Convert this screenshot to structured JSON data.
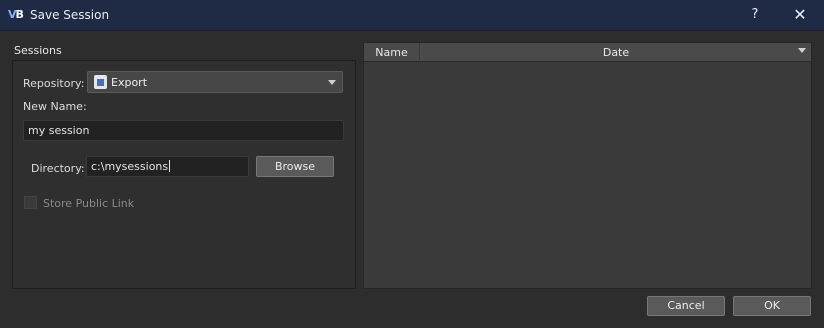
{
  "window": {
    "title": "Save Session",
    "app_icon": "VB",
    "help_label": "?",
    "close_label": "✕"
  },
  "sessions": {
    "section_label": "Sessions",
    "repository_label": "Repository:",
    "repository_value": "Export",
    "new_name_label": "New Name:",
    "new_name_value": "my session",
    "directory_label": "Directory:",
    "directory_value": "c:\\mysessions",
    "browse_label": "Browse",
    "store_public_link_label": "Store Public Link",
    "store_public_link_checked": false
  },
  "table": {
    "columns": [
      "Name",
      "Date"
    ],
    "sort_column": "Date",
    "sort_direction": "descending",
    "rows": []
  },
  "footer": {
    "cancel_label": "Cancel",
    "ok_label": "OK"
  },
  "colors": {
    "titlebar": "#1f2a44",
    "background": "#2d2d2d",
    "accent": "#3e72c4"
  }
}
